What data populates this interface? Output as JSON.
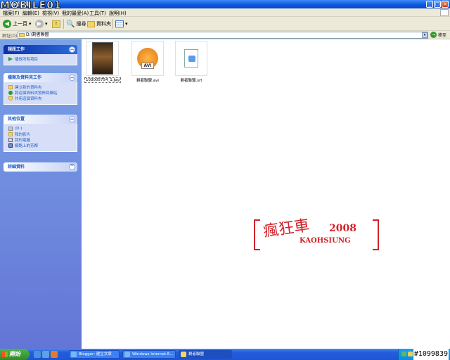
{
  "window": {
    "title": "剩者聯盟"
  },
  "brand": {
    "logo_text": "MOBILE01"
  },
  "menu": [
    "檔案(F)",
    "編輯(E)",
    "檢視(V)",
    "我的最愛(A)",
    "工具(T)",
    "說明(H)"
  ],
  "toolbar": {
    "back": "上一頁",
    "search": "搜尋",
    "folders": "資料夾"
  },
  "address": {
    "label": "網址(D)",
    "path": "D:\\剩者聯盟",
    "go": "移至"
  },
  "sidebar": {
    "video_tasks": {
      "title": "視訊工作",
      "items": [
        "播放所有項目"
      ]
    },
    "file_tasks": {
      "title": "檔案及資料夾工作",
      "items": [
        "建立新的資料夾",
        "將這個資料夾發佈到網站",
        "共用這個資料夾"
      ]
    },
    "other_places": {
      "title": "其他位置",
      "items": [
        "(D:)",
        "我的影片",
        "我的電腦",
        "網路上的芳鄰"
      ]
    },
    "details": {
      "title": "詳細資料"
    }
  },
  "files": [
    {
      "name": "103005754_1.jpg",
      "type": "jpg"
    },
    {
      "name": "剩者聯盟.avi",
      "type": "avi"
    },
    {
      "name": "剩者聯盟.srt",
      "type": "srt"
    }
  ],
  "watermark": {
    "line1": "瘋狂車",
    "line2": "2008",
    "line3": "KAOHSIUNG"
  },
  "taskbar": {
    "start": "開始",
    "tasks": [
      "Blogger: 建立文章",
      "Windows Internet E...",
      "剩者聯盟"
    ],
    "id_label": "#1099839"
  },
  "colors": {
    "accent": "#0a54e0",
    "watermark": "#d2232a",
    "sidebar": "#7ba2e7"
  }
}
